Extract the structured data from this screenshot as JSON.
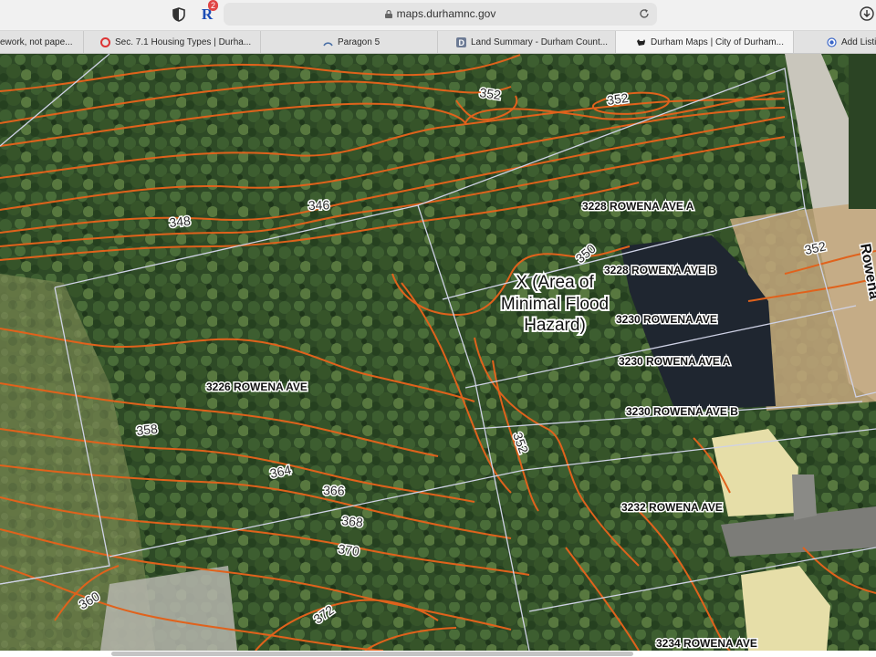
{
  "browser": {
    "url": "maps.durhamnc.gov",
    "extension_badge": "2",
    "extension_letter": "R"
  },
  "tabs": [
    {
      "label": "ework, not pape..."
    },
    {
      "label": "Sec. 7.1 Housing Types | Durha..."
    },
    {
      "label": "Paragon 5"
    },
    {
      "label": "Land Summary - Durham Count..."
    },
    {
      "label": "Durham Maps | City of Durham..."
    },
    {
      "label": "Add Listi"
    }
  ],
  "map": {
    "street_name": "Rowena",
    "flood_zone_label": [
      "X (Area of",
      "Minimal Flood",
      "Hazard)"
    ],
    "parcels": [
      {
        "label": "3228 ROWENA AVE A"
      },
      {
        "label": "3228 ROWENA AVE B"
      },
      {
        "label": "3230 ROWENA AVE"
      },
      {
        "label": "3230 ROWENA AVE A"
      },
      {
        "label": "3230 ROWENA AVE B"
      },
      {
        "label": "3226 ROWENA AVE"
      },
      {
        "label": "3232 ROWENA AVE"
      },
      {
        "label": "3234 ROWENA AVE"
      }
    ],
    "contours": [
      {
        "label": "352"
      },
      {
        "label": "352"
      },
      {
        "label": "346"
      },
      {
        "label": "348"
      },
      {
        "label": "352"
      },
      {
        "label": "358"
      },
      {
        "label": "364"
      },
      {
        "label": "366"
      },
      {
        "label": "368"
      },
      {
        "label": "370"
      },
      {
        "label": "360"
      },
      {
        "label": "372"
      },
      {
        "label": "352"
      },
      {
        "label": "350"
      }
    ],
    "contour_color": "#e0621c",
    "parcel_line_color": "#cfd2e6"
  }
}
